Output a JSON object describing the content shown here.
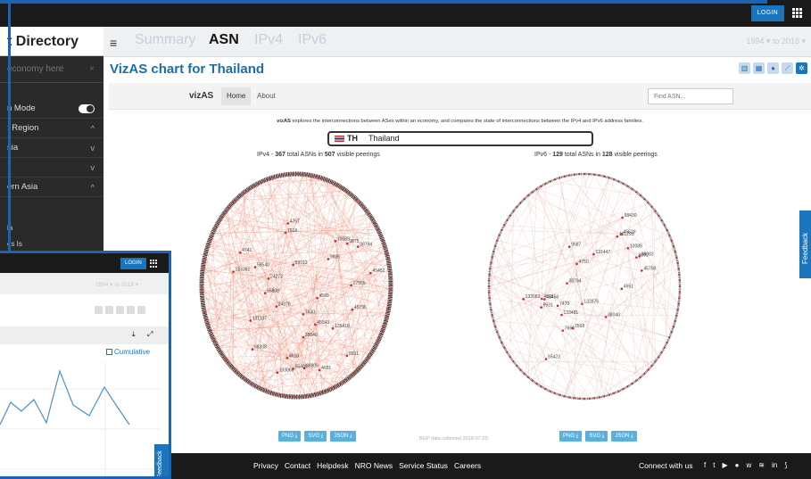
{
  "header": {
    "login_label": "LOGIN"
  },
  "sidebar": {
    "title": "t Directory",
    "search_placeholder": "economy here",
    "rows": [
      {
        "label": "n Mode",
        "kind": "toggle"
      },
      {
        "label": ": Region",
        "kind": "chev",
        "chev": "^"
      },
      {
        "label": "sia",
        "kind": "chev",
        "chev": "v"
      },
      {
        "label": "",
        "kind": "chev",
        "chev": "v"
      },
      {
        "label": "ern Asia",
        "kind": "chev",
        "chev": "^"
      }
    ],
    "sub_items": [
      "ia",
      "es Is"
    ]
  },
  "tabs": {
    "items": [
      "Summary",
      "ASN",
      "IPv4",
      "IPv6"
    ],
    "active": "ASN",
    "date_range": "1994 ▾  to  2018 ▾"
  },
  "chart_title": "VizAS chart for Thailand",
  "vizas": {
    "brand": "vizAS",
    "nav_home": "Home",
    "nav_about": "About",
    "find_placeholder": "Find ASN...",
    "description_bold": "vizAS",
    "description": " explores the interconnections between ASes within an economy, and compares the state of interconnections between the IPv4 and IPv6 address families.",
    "country_code": "TH",
    "country_name": "Thailand",
    "ipv4": {
      "prefix": "IPv4 - ",
      "asns": "367",
      "mid": " total ASNs in ",
      "peerings": "507",
      "suffix": " visible peerings"
    },
    "ipv6": {
      "prefix": "IPv6 - ",
      "asns": "129",
      "mid": " total ASNs in ",
      "peerings": "128",
      "suffix": " visible peerings"
    },
    "ipv4_labels": [
      "4767",
      "4741",
      "4599",
      "7630",
      "135418",
      "133068",
      "38809",
      "17565",
      "4618",
      "9931",
      "24273",
      "58308",
      "55409",
      "45796",
      "10089",
      "38794",
      "9835",
      "45543",
      "55808",
      "131107",
      "58540",
      "38040",
      "9875",
      "24378",
      "133381",
      "59013",
      "45452",
      "7616",
      "4651"
    ],
    "ipv6_labels": [
      "7693",
      "58430",
      "7568",
      "4618",
      "9891",
      "132876",
      "131447",
      "4651",
      "9587",
      "4750",
      "7470",
      "45629",
      "45456",
      "132083",
      "38040",
      "9931",
      "38794",
      "131293",
      "45758",
      "10089",
      "55423",
      "133481",
      "38082"
    ],
    "downloads": [
      "PNG ⤓",
      "SVG ⤓",
      "JSON ⤓"
    ],
    "bgp_note": "BGP data collected 2018-07-23."
  },
  "footer": {
    "links": [
      "Privacy",
      "Contact",
      "Helpdesk",
      "NRO News",
      "Service Status",
      "Careers"
    ],
    "connect": "Connect with us",
    "social_icons": [
      "facebook-icon",
      "twitter-icon",
      "youtube-icon",
      "flickr-icon",
      "weibo-icon",
      "rss-feed-icon",
      "linkedin-icon",
      "rss-icon"
    ]
  },
  "feedback_label": "Feedback",
  "overlay2": {
    "login_label": "LOGIN",
    "date_range": "1994 ▾  to  2018 ▾",
    "cumulative_label": "Cumulative",
    "feedback_label": "Feedback"
  },
  "colors": {
    "accent": "#1b75bc",
    "title": "#1b6fa8",
    "dark": "#1a1a1a",
    "edge_v4": "#e8836a",
    "edge_v6": "#d9a090"
  }
}
